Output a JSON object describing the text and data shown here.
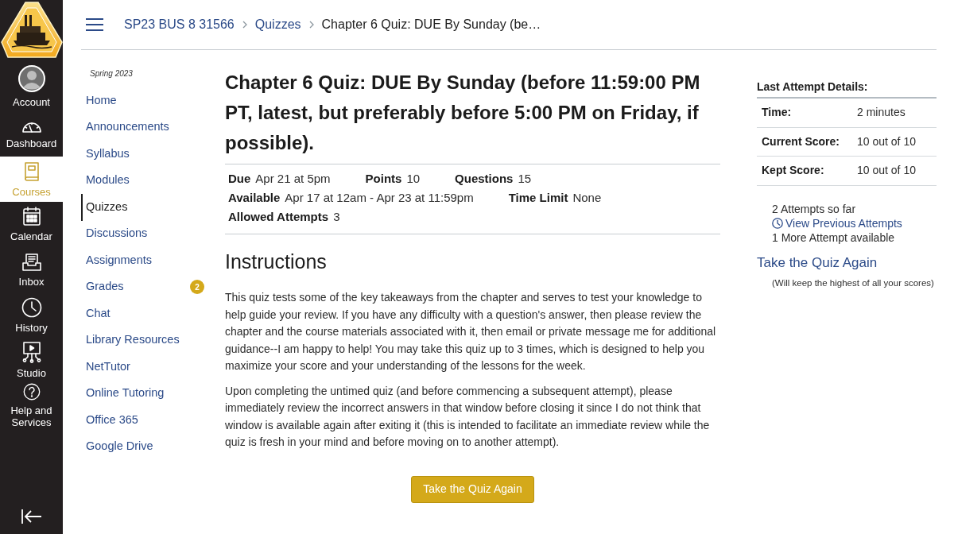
{
  "global_nav": {
    "items": [
      {
        "kind": "account",
        "label": "Account",
        "selected": false
      },
      {
        "kind": "dashboard",
        "label": "Dashboard",
        "selected": false
      },
      {
        "kind": "courses",
        "label": "Courses",
        "selected": true
      },
      {
        "kind": "calendar",
        "label": "Calendar",
        "selected": false
      },
      {
        "kind": "inbox",
        "label": "Inbox",
        "selected": false
      },
      {
        "kind": "history",
        "label": "History",
        "selected": false
      },
      {
        "kind": "studio",
        "label": "Studio",
        "selected": false
      },
      {
        "kind": "help",
        "label": "Help and Services",
        "selected": false
      }
    ]
  },
  "breadcrumb": [
    {
      "kind": "link",
      "label": "SP23 BUS 8 31566"
    },
    {
      "kind": "link",
      "label": "Quizzes"
    },
    {
      "kind": "current",
      "label": "Chapter 6 Quiz: DUE By Sunday (be…"
    }
  ],
  "course_nav": {
    "term": "Spring 2023",
    "items": [
      {
        "label": "Home",
        "selected": false
      },
      {
        "label": "Announcements",
        "selected": false
      },
      {
        "label": "Syllabus",
        "selected": false
      },
      {
        "label": "Modules",
        "selected": false
      },
      {
        "label": "Quizzes",
        "selected": true
      },
      {
        "label": "Discussions",
        "selected": false
      },
      {
        "label": "Assignments",
        "selected": false
      },
      {
        "label": "Grades",
        "selected": false,
        "badge": "2"
      },
      {
        "label": "Chat",
        "selected": false
      },
      {
        "label": "Library Resources",
        "selected": false
      },
      {
        "label": "NetTutor",
        "selected": false
      },
      {
        "label": "Online Tutoring",
        "selected": false
      },
      {
        "label": "Office 365",
        "selected": false
      },
      {
        "label": "Google Drive",
        "selected": false
      }
    ]
  },
  "quiz": {
    "title": "Chapter 6 Quiz: DUE By Sunday (before 11:59:00 PM PT, latest, but preferably before 5:00 PM on Friday, if possible).",
    "details": [
      [
        {
          "label": "Due",
          "value": "Apr 21 at 5pm"
        },
        {
          "label": "Points",
          "value": "10"
        },
        {
          "label": "Questions",
          "value": "15"
        }
      ],
      [
        {
          "label": "Available",
          "value": "Apr 17 at 12am - Apr 23 at 11:59pm"
        },
        {
          "label": "Time Limit",
          "value": "None"
        }
      ],
      [
        {
          "label": "Allowed Attempts",
          "value": "3"
        }
      ]
    ],
    "instructions_heading": "Instructions",
    "paragraphs": [
      "This quiz tests some of the key takeaways from the chapter and serves to test your knowledge to help guide your review. If you have any difficulty with a question's answer, then please review the chapter and the course materials associated with it, then email or private message me for additional guidance--I am happy to help! You may take this quiz up to 3 times, which is designed to help you maximize your score and your understanding of the lessons for the week.",
      "Upon completing the untimed quiz (and before commencing a subsequent attempt), please immediately review the incorrect answers in that window before closing it since I do not think that window is available again after exiting it (this is intended to facilitate an immediate review while the quiz is fresh in your mind and before moving on to another attempt)."
    ],
    "button": "Take the Quiz Again"
  },
  "last_attempt": {
    "heading": "Last Attempt Details:",
    "rows": [
      {
        "label": "Time:",
        "value": "2 minutes"
      },
      {
        "label": "Current Score:",
        "value": "10 out of 10"
      },
      {
        "label": "Kept Score:",
        "value": "10 out of 10"
      }
    ],
    "attempts": "2 Attempts so far",
    "history_link": "View Previous Attempts",
    "remaining": "1 More Attempt available",
    "retake_link": "Take the Quiz Again",
    "note": "(Will keep the highest of all your scores)"
  }
}
